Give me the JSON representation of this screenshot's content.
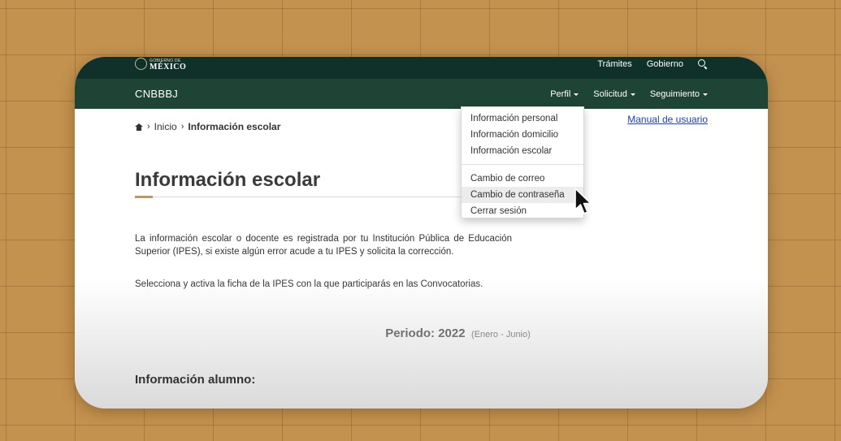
{
  "gov_bar": {
    "logo_small": "GOBIERNO DE",
    "logo_big": "MÉXICO",
    "links": [
      "Trámites",
      "Gobierno"
    ]
  },
  "site_bar": {
    "title": "CNBBBJ",
    "menu": [
      "Perfil",
      "Solicitud",
      "Seguimiento"
    ]
  },
  "dropdown": {
    "group1": [
      "Información personal",
      "Información domicilio",
      "Información escolar"
    ],
    "group2": [
      "Cambio de correo",
      "Cambio de contraseña",
      "Cerrar sesión"
    ],
    "hovered_item": "Cambio de contraseña"
  },
  "breadcrumb": {
    "home": "Inicio",
    "current": "Información escolar"
  },
  "manual_link": "Manual de usuario",
  "page_title": "Información escolar",
  "paragraph": "La información escolar o docente es registrada por tu Institución Pública de Educación Superior (IPES), si existe algún error acude a tu IPES y solicita la corrección.",
  "paragraph2": "Selecciona y activa la ficha de la IPES con la que participarás en las Convocatorias.",
  "period": {
    "label": "Periodo: 2022",
    "range": "(Enero - Junio)"
  },
  "section_title": "Información alumno:",
  "colors": {
    "gov_bar": "#10302a",
    "site_bar": "#1e4436",
    "accent": "#b89a63",
    "link": "#1a3fb0"
  },
  "icons": [
    "seal-icon",
    "search-icon",
    "home-icon",
    "caret-down-icon",
    "mouse-pointer-icon"
  ]
}
